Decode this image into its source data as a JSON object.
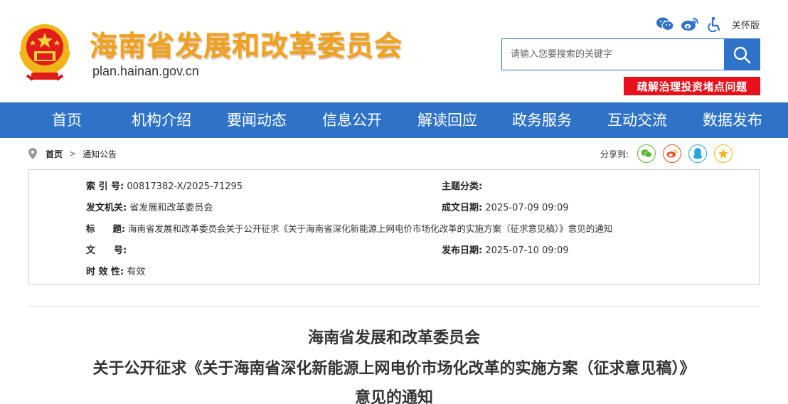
{
  "header": {
    "site_title": "海南省发展和改革委员会",
    "site_domain": "plan.hainan.gov.cn",
    "care_mode": "关怀版",
    "search_placeholder": "请输入您要搜索的关键字",
    "banner": "疏解治理投资堵点问题"
  },
  "nav": {
    "items": [
      "首页",
      "机构介绍",
      "要闻动态",
      "信息公开",
      "解读回应",
      "政务服务",
      "互动交流",
      "数据发布"
    ]
  },
  "breadcrumb": {
    "home": "首页",
    "separator": ">",
    "current": "通知公告"
  },
  "share": {
    "label": "分享到:",
    "icons": [
      "wechat-icon",
      "weibo-icon",
      "qq-icon",
      "qzone-icon"
    ]
  },
  "meta": {
    "index_label": "索 引 号:",
    "index_value": "00817382-X/2025-71295",
    "topic_label": "主题分类:",
    "topic_value": "",
    "issuer_label": "发文机关:",
    "issuer_value": "省发展和改革委员会",
    "created_label": "成文日期:",
    "created_value": "2025-07-09 09:09",
    "title_label": "标　　题:",
    "title_value": "海南省发展和改革委员会关于公开征求《关于海南省深化新能源上网电价市场化改革的实施方案（征求意见稿）》意见的通知",
    "docno_label": "文　　号:",
    "docno_value": "",
    "published_label": "发布日期:",
    "published_value": "2025-07-10 09:09",
    "validity_label": "时 效 性:",
    "validity_value": "有效"
  },
  "document": {
    "title_line1": "海南省发展和改革委员会",
    "title_line2": "关于公开征求《关于海南省深化新能源上网电价市场化改革的实施方案（征求意见稿）》",
    "title_line3": "意见的通知"
  },
  "colors": {
    "primary_blue": "#2f73c8",
    "title_gold": "#f0a21c",
    "banner_red": "#e8101a"
  }
}
